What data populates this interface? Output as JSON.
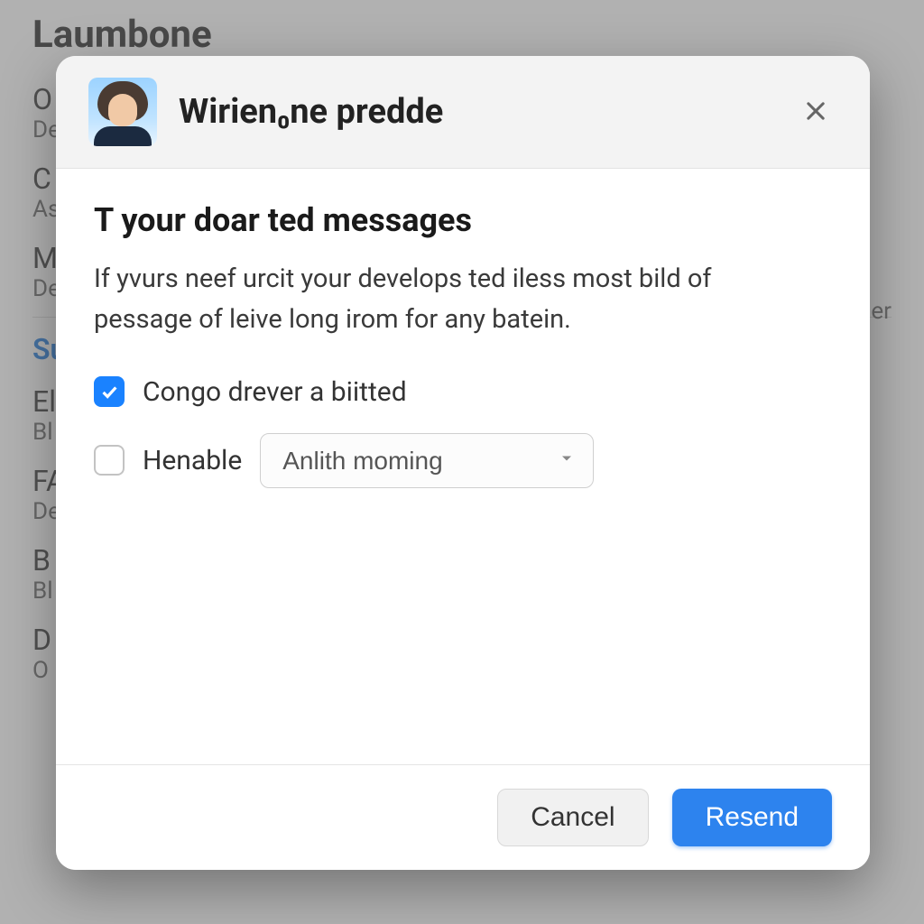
{
  "background": {
    "title": "Laumbone",
    "items": [
      {
        "title": "O",
        "sub": "De"
      },
      {
        "title": "C",
        "sub": "As"
      },
      {
        "title": "M",
        "sub": "De"
      },
      {
        "title": "Su",
        "sub": "",
        "highlight": true
      },
      {
        "title": "El",
        "sub": "Bl"
      },
      {
        "title": "FA",
        "sub": "De"
      },
      {
        "title": "B",
        "sub": "Bl"
      },
      {
        "title": "D",
        "sub": "O"
      }
    ],
    "right_text": "er"
  },
  "modal": {
    "title": "Wirien₀ne predde",
    "section_heading": "T your doar ted messages",
    "section_desc": "If yvurs neef urcit your develops ted iless most bild of pessage of leive long irom for any batein.",
    "option1": {
      "checked": true,
      "label": "Congo drever a biitted"
    },
    "option2": {
      "checked": false,
      "label": "Henable"
    },
    "select_value": "Anlith moming",
    "cancel": "Cancel",
    "resend": "Resend"
  }
}
